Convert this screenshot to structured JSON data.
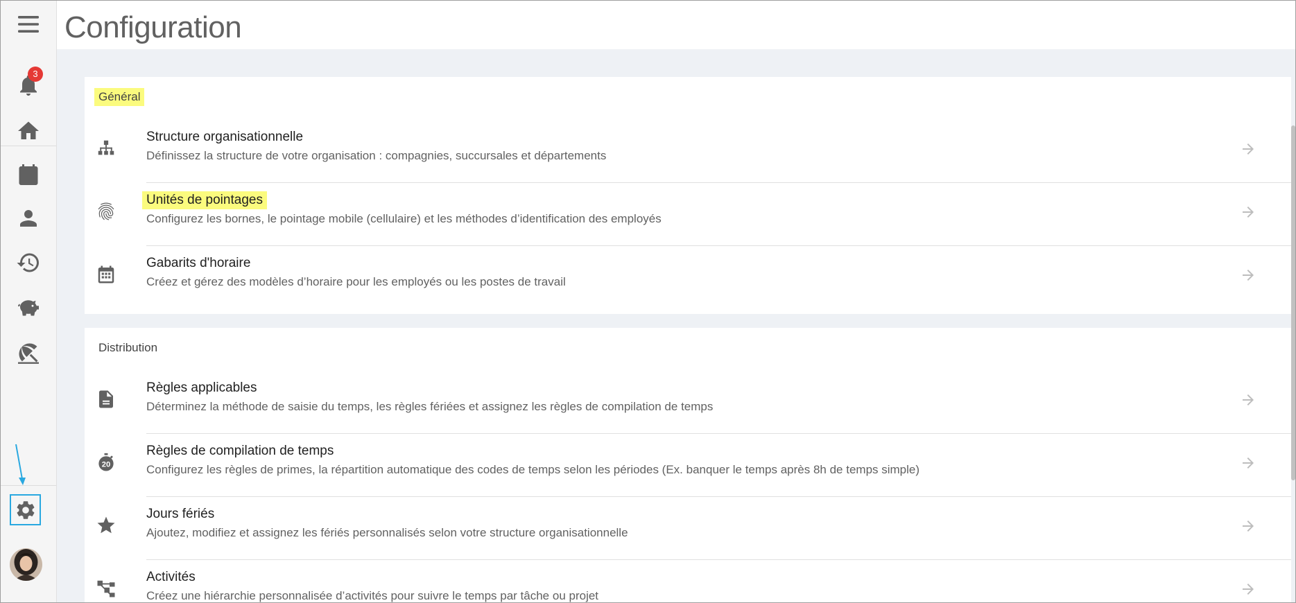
{
  "header": {
    "title": "Configuration"
  },
  "sidebar": {
    "notifications_count": "3",
    "items": [
      {
        "icon": "menu-icon"
      },
      {
        "icon": "bell-icon"
      },
      {
        "icon": "home-icon"
      },
      {
        "icon": "calendar-icon"
      },
      {
        "icon": "person-icon"
      },
      {
        "icon": "history-icon"
      },
      {
        "icon": "piggy-bank-icon"
      },
      {
        "icon": "beach-umbrella-icon"
      },
      {
        "icon": "gear-icon"
      },
      {
        "icon": "avatar"
      }
    ],
    "accent_color": "#29a8e0"
  },
  "sections": [
    {
      "title": "Général",
      "rows": [
        {
          "icon": "org-chart-icon",
          "title": "Structure organisationnelle",
          "description": "Définissez la structure de votre organisation : compagnies, succursales et départements"
        },
        {
          "icon": "fingerprint-icon",
          "title": "Unités de pointages",
          "description": "Configurez les bornes, le pointage mobile (cellulaire) et les méthodes d’identification des employés"
        },
        {
          "icon": "calendar-grid-icon",
          "title": "Gabarits d'horaire",
          "description": "Créez et gérez des modèles d’horaire pour les employés ou les postes de travail"
        }
      ]
    },
    {
      "title": "Distribution",
      "rows": [
        {
          "icon": "document-icon",
          "title": "Règles applicables",
          "description": "Déterminez la méthode de saisie du temps, les règles fériées et assignez les règles de compilation de temps"
        },
        {
          "icon": "stopwatch-20-icon",
          "title": "Règles de compilation de temps",
          "description": "Configurez les règles de primes, la répartition automatique des codes de temps selon les périodes (Ex. banquer le temps après 8h de temps simple)"
        },
        {
          "icon": "star-icon",
          "title": "Jours fériés",
          "description": "Ajoutez, modifiez et assignez les fériés personnalisés selon votre structure organisationnelle"
        },
        {
          "icon": "hierarchy-icon",
          "title": "Activités",
          "description": "Créez une hiérarchie personnalisée d’activités pour suivre le temps par tâche ou projet"
        }
      ]
    }
  ],
  "colors": {
    "highlight": "#fbfb7e",
    "background": "#eef1f5",
    "icon": "#616161"
  },
  "stopwatch_label": "20"
}
